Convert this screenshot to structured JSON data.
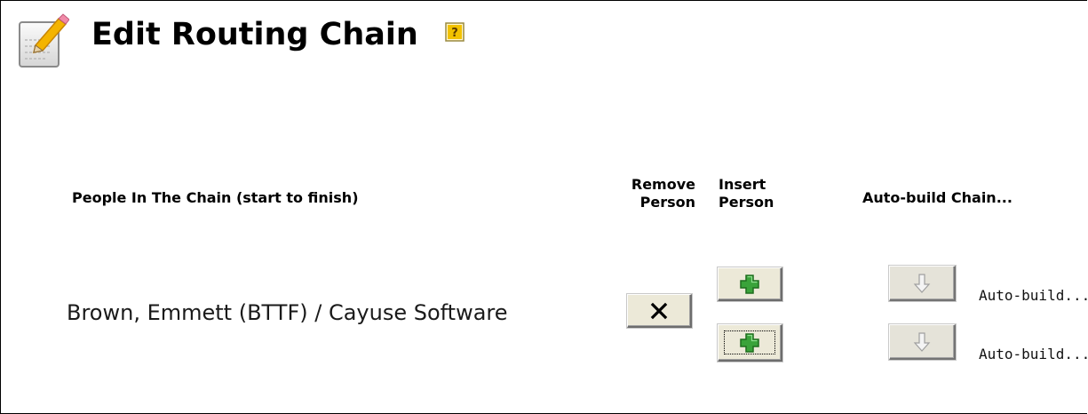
{
  "header": {
    "title": "Edit Routing Chain",
    "edit_icon": "notepad-pencil-icon",
    "help_icon": "help-question-icon",
    "help_label": "?"
  },
  "table": {
    "columns": {
      "people": "People In The Chain (start to finish)",
      "remove_line1": "Remove",
      "remove_line2": "Person",
      "insert_line1": "Insert",
      "insert_line2": "Person",
      "auto": "Auto-build Chain..."
    },
    "rows": [
      {
        "person": "Brown, Emmett (BTTF) / Cayuse Software"
      }
    ],
    "remove_icon": "x-close-icon",
    "insert_icon": "green-plus-icon",
    "auto_icon": "arrow-down-icon",
    "auto_labels": [
      "Auto-build...",
      "Auto-build..."
    ]
  },
  "colors": {
    "insert_plus": "#3aa33a",
    "button_face": "#ece9d8",
    "help_badge": "#f2c200"
  }
}
